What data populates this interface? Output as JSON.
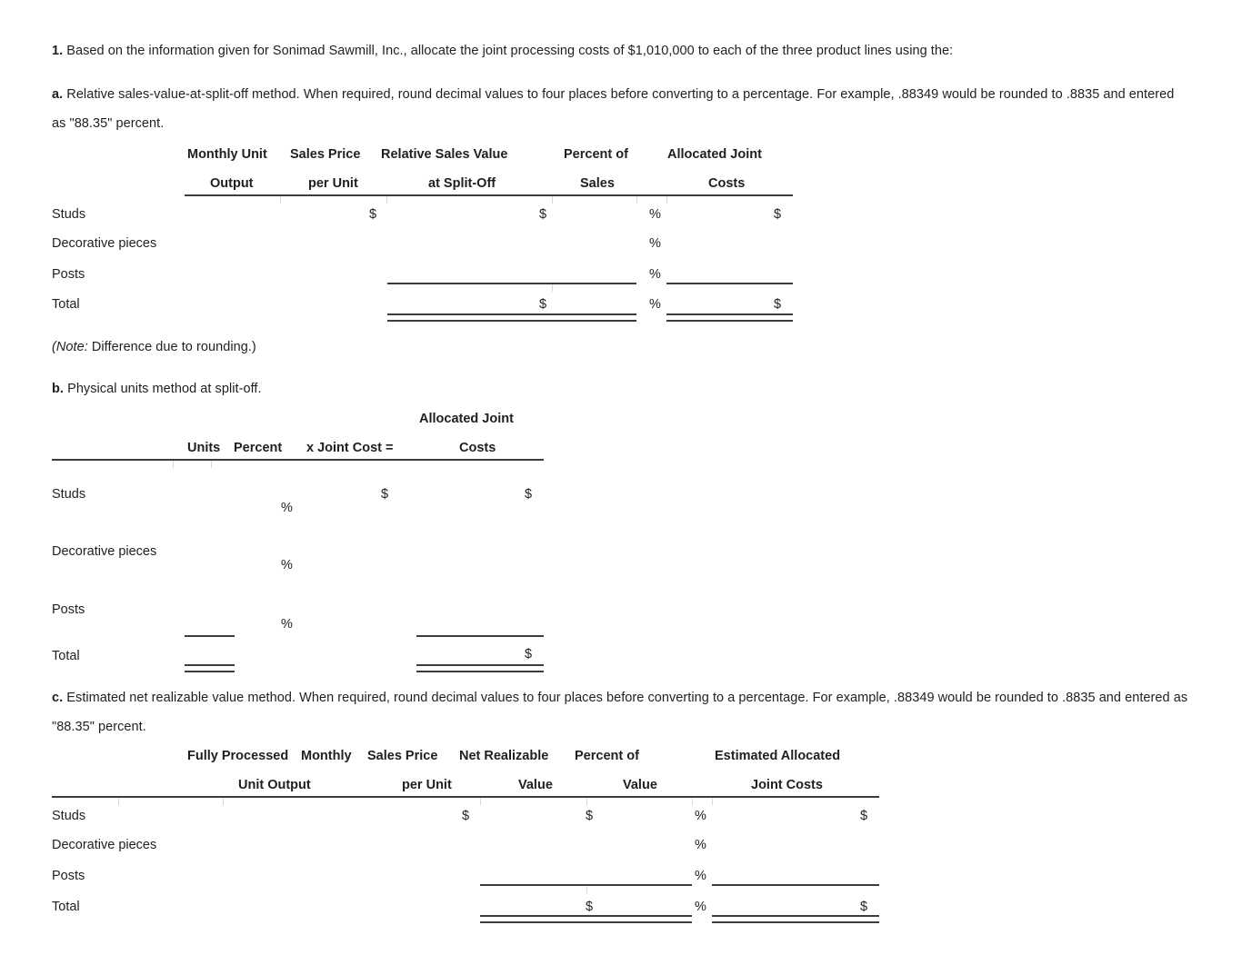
{
  "question": {
    "number": "1.",
    "prompt": "Based on the information given for Sonimad Sawmill, Inc., allocate the joint processing costs of $1,010,000 to each of the three product lines using the:",
    "joint_cost": "$1,010,000",
    "company": "Sonimad Sawmill, Inc."
  },
  "parts": {
    "a": {
      "letter": "a.",
      "text": "Relative sales-value-at-split-off method. When required, round decimal values to four places before converting to a percentage. For example, .88349 would be rounded to .8835 and entered as \"88.35\" percent.",
      "note": "Difference due to rounding.)",
      "note_label": "(Note:",
      "table": {
        "header_top": [
          "Monthly Unit",
          "Sales Price",
          "Relative Sales Value",
          "Percent of",
          "Allocated Joint"
        ],
        "header_bottom": [
          "Output",
          "per Unit",
          "at Split-Off",
          "Sales",
          "Costs"
        ],
        "rows": [
          {
            "label": "Studs",
            "output": "",
            "price_symbol": "$",
            "price": "",
            "rsv_symbol": "$",
            "rsv": "",
            "percent_symbol": "%",
            "percent": "",
            "alloc_symbol": "$",
            "alloc": ""
          },
          {
            "label": "Decorative pieces",
            "output": "",
            "price_symbol": "",
            "price": "",
            "rsv_symbol": "",
            "rsv": "",
            "percent_symbol": "%",
            "percent": "",
            "alloc_symbol": "",
            "alloc": ""
          },
          {
            "label": "Posts",
            "output": "",
            "price_symbol": "",
            "price": "",
            "rsv_symbol": "",
            "rsv": "",
            "percent_symbol": "%",
            "percent": "",
            "alloc_symbol": "",
            "alloc": ""
          },
          {
            "label": "Total",
            "output": "",
            "price_symbol": "",
            "price": "",
            "rsv_symbol": "$",
            "rsv": "",
            "percent_symbol": "%",
            "percent": "",
            "alloc_symbol": "$",
            "alloc": ""
          }
        ]
      }
    },
    "b": {
      "letter": "b.",
      "text": "Physical units method at split-off.",
      "table": {
        "header_top": [
          "Allocated Joint"
        ],
        "header_bottom": [
          "Units",
          "Percent",
          "x Joint Cost =",
          "Costs"
        ],
        "rows": [
          {
            "label": "Studs",
            "units": "",
            "percent_symbol": "%",
            "percent": "",
            "jc_symbol": "$",
            "joint_cost": "",
            "alloc_symbol": "$",
            "alloc": ""
          },
          {
            "label": "Decorative pieces",
            "units": "",
            "percent_symbol": "%",
            "percent": "",
            "jc_symbol": "",
            "joint_cost": "",
            "alloc_symbol": "",
            "alloc": ""
          },
          {
            "label": "Posts",
            "units": "",
            "percent_symbol": "%",
            "percent": "",
            "jc_symbol": "",
            "joint_cost": "",
            "alloc_symbol": "",
            "alloc": ""
          },
          {
            "label": "Total",
            "units": "",
            "percent_symbol": "",
            "percent": "",
            "jc_symbol": "",
            "joint_cost": "",
            "alloc_symbol": "$",
            "alloc": ""
          }
        ]
      }
    },
    "c": {
      "letter": "c.",
      "text": "Estimated net realizable value method. When required, round decimal values to four places before converting to a percentage. For example, .88349 would be rounded to .8835 and entered as \"88.35\" percent.",
      "table": {
        "header_top": [
          "Fully Processed",
          "Monthly",
          "Sales Price",
          "Net Realizable",
          "Percent of",
          "Estimated Allocated"
        ],
        "header_bottom": [
          "Unit Output",
          "per Unit",
          "Value",
          "Value",
          "Joint Costs"
        ],
        "rows": [
          {
            "label": "Studs",
            "units": "",
            "price_symbol": "$",
            "price": "",
            "nrv_symbol": "$",
            "nrv": "",
            "percent_symbol": "%",
            "percent": "",
            "alloc_symbol": "$",
            "alloc": ""
          },
          {
            "label": "Decorative pieces",
            "units": "",
            "price_symbol": "",
            "price": "",
            "nrv_symbol": "",
            "nrv": "",
            "percent_symbol": "%",
            "percent": "",
            "alloc_symbol": "",
            "alloc": ""
          },
          {
            "label": "Posts",
            "units": "",
            "price_symbol": "",
            "price": "",
            "nrv_symbol": "",
            "nrv": "",
            "percent_symbol": "%",
            "percent": "",
            "alloc_symbol": "",
            "alloc": ""
          },
          {
            "label": "Total",
            "units": "",
            "price_symbol": "",
            "price": "",
            "nrv_symbol": "$",
            "nrv": "",
            "percent_symbol": "%",
            "percent": "",
            "alloc_symbol": "$",
            "alloc": ""
          }
        ]
      }
    }
  },
  "colors": {
    "text": "#1f1f1f",
    "rule": "#3c3c3c",
    "background": "#ffffff"
  }
}
